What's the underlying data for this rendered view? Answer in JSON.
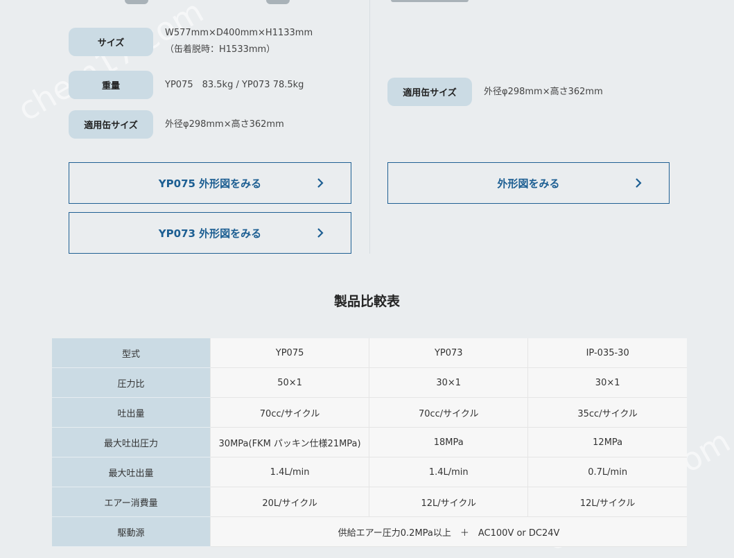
{
  "specs_left": [
    {
      "label": "サイズ",
      "value": "W577mm×D400mm×H1133mm",
      "value2": "（缶着脱時：H1533mm）"
    },
    {
      "label": "重量",
      "value": "YP075　83.5kg / YP073 78.5kg"
    },
    {
      "label": "適用缶サイズ",
      "value": "外径φ298mm×高さ362mm"
    }
  ],
  "specs_right": [
    {
      "label": "適用缶サイズ",
      "value": "外径φ298mm×高さ362mm"
    }
  ],
  "buttons": {
    "yp075": "YP075 外形図をみる",
    "yp073": "YP073 外形図をみる",
    "right": "外形図をみる"
  },
  "comparison": {
    "title": "製品比較表",
    "header": {
      "label": "型式",
      "cols": [
        "YP075",
        "YP073",
        "IP-035-30"
      ]
    },
    "rows": [
      {
        "label": "圧力比",
        "cells": [
          "50×1",
          "30×1",
          "30×1"
        ]
      },
      {
        "label": "吐出量",
        "cells": [
          "70cc/サイクル",
          "70cc/サイクル",
          "35cc/サイクル"
        ]
      },
      {
        "label": "最大吐出圧力",
        "cells": [
          "30MPa(FKM パッキン仕様21MPa)",
          "18MPa",
          "12MPa"
        ]
      },
      {
        "label": "最大吐出量",
        "cells": [
          "1.4L/min",
          "1.4L/min",
          "0.7L/min"
        ]
      },
      {
        "label": "エアー消費量",
        "cells": [
          "20L/サイクル",
          "12L/サイクル",
          "12L/サイクル"
        ]
      }
    ],
    "drive": {
      "label": "駆動源",
      "value": "供給エアー圧力0.2MPa以上　＋　AC100V or DC24V"
    }
  },
  "watermark": "chem17.com",
  "colors": {
    "accent": "#1c5e92",
    "pill": "#cbdbe4",
    "background": "#eaedef"
  }
}
